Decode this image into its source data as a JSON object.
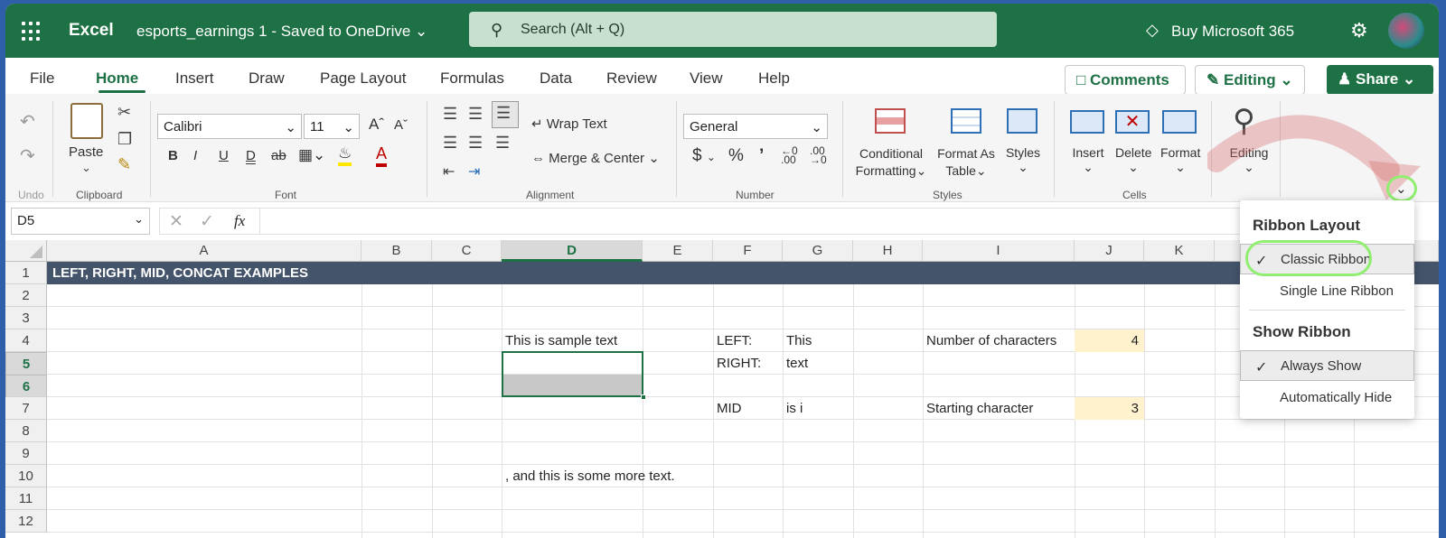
{
  "title_bar": {
    "app_name": "Excel",
    "document_name": "esports_earnings 1  -  Saved to OneDrive ⌄",
    "search_placeholder": "Search (Alt + Q)",
    "buy_label": "Buy Microsoft 365"
  },
  "tabs": [
    "File",
    "Home",
    "Insert",
    "Draw",
    "Page Layout",
    "Formulas",
    "Data",
    "Review",
    "View",
    "Help"
  ],
  "active_tab": "Home",
  "actions": {
    "comments": "Comments",
    "editing": "Editing",
    "share": "Share"
  },
  "ribbon": {
    "groups": {
      "undo": "Undo",
      "clipboard": "Clipboard",
      "font": "Font",
      "alignment": "Alignment",
      "number": "Number",
      "styles": "Styles",
      "cells": "Cells"
    },
    "paste": "Paste",
    "font_name": "Calibri",
    "font_size": "11",
    "wrap_text": "Wrap Text",
    "merge_center": "Merge & Center",
    "number_format": "General",
    "conditional_formatting": [
      "Conditional",
      "Formatting"
    ],
    "format_as_table": [
      "Format As",
      "Table"
    ],
    "styles": "Styles",
    "insert": "Insert",
    "delete": "Delete",
    "format": "Format",
    "editing": "Editing"
  },
  "formula_bar": {
    "name_box": "D5",
    "fx": "fx"
  },
  "columns": [
    "A",
    "B",
    "C",
    "D",
    "E",
    "F",
    "G",
    "H",
    "I",
    "J",
    "K"
  ],
  "rows": [
    "1",
    "2",
    "3",
    "4",
    "5",
    "6",
    "7",
    "8",
    "9",
    "10",
    "11",
    "12"
  ],
  "cells": {
    "A1": "LEFT, RIGHT, MID, CONCAT EXAMPLES",
    "D4": "This is sample text",
    "F4": "LEFT:",
    "G4": "This",
    "I4": "Number of characters",
    "J4": "4",
    "F5": "RIGHT:",
    "G5": "text",
    "F7": "MID",
    "G7": "is i",
    "I7": "Starting character",
    "J7": "3",
    "D10": ", and this is some more text."
  },
  "ribbon_menu": {
    "layout_header": "Ribbon Layout",
    "layout_options": [
      "Classic Ribbon",
      "Single Line Ribbon"
    ],
    "show_header": "Show Ribbon",
    "show_options": [
      "Always Show",
      "Automatically Hide"
    ]
  },
  "colors": {
    "brand": "#1e7145",
    "header_row": "#44546a",
    "highlight_cell": "#fff2cc",
    "annotation": "#90ee70"
  }
}
